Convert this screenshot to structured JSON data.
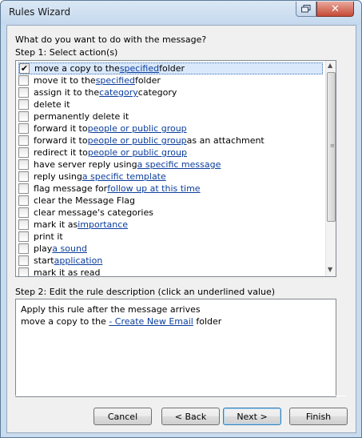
{
  "window": {
    "title": "Rules Wizard",
    "close_glyph": "✕"
  },
  "prompt": "What do you want to do with the message?",
  "step1_label": "Step 1: Select action(s)",
  "actions": [
    {
      "checked": true,
      "pre": "move a copy to the ",
      "link": "specified",
      "post": " folder",
      "selected": true
    },
    {
      "checked": false,
      "pre": "move it to the ",
      "link": "specified",
      "post": " folder"
    },
    {
      "checked": false,
      "pre": "assign it to the ",
      "link": "category",
      "post": " category"
    },
    {
      "checked": false,
      "pre": "delete it",
      "link": "",
      "post": ""
    },
    {
      "checked": false,
      "pre": "permanently delete it",
      "link": "",
      "post": ""
    },
    {
      "checked": false,
      "pre": "forward it to ",
      "link": "people or public group",
      "post": ""
    },
    {
      "checked": false,
      "pre": "forward it to ",
      "link": "people or public group",
      "post": " as an attachment"
    },
    {
      "checked": false,
      "pre": "redirect it to ",
      "link": "people or public group",
      "post": ""
    },
    {
      "checked": false,
      "pre": "have server reply using ",
      "link": "a specific message",
      "post": ""
    },
    {
      "checked": false,
      "pre": "reply using ",
      "link": "a specific template",
      "post": ""
    },
    {
      "checked": false,
      "pre": "flag message for ",
      "link": "follow up at this time",
      "post": ""
    },
    {
      "checked": false,
      "pre": "clear the Message Flag",
      "link": "",
      "post": ""
    },
    {
      "checked": false,
      "pre": "clear message's categories",
      "link": "",
      "post": ""
    },
    {
      "checked": false,
      "pre": "mark it as ",
      "link": "importance",
      "post": ""
    },
    {
      "checked": false,
      "pre": "print it",
      "link": "",
      "post": ""
    },
    {
      "checked": false,
      "pre": "play ",
      "link": "a sound",
      "post": ""
    },
    {
      "checked": false,
      "pre": "start ",
      "link": "application",
      "post": ""
    },
    {
      "checked": false,
      "pre": "mark it as read",
      "link": "",
      "post": ""
    }
  ],
  "step2_label": "Step 2: Edit the rule description (click an underlined value)",
  "description": {
    "line1": "Apply this rule after the message arrives",
    "line2_pre": "move a copy to the ",
    "line2_link": "- Create New Email",
    "line2_post": " folder"
  },
  "buttons": {
    "cancel": "Cancel",
    "back": "< Back",
    "next": "Next >",
    "finish": "Finish"
  },
  "check_glyph": "✔",
  "colors": {
    "link": "#0b3d9c",
    "selection": "#d9e8fb",
    "client_bg": "#f0f0f0"
  }
}
